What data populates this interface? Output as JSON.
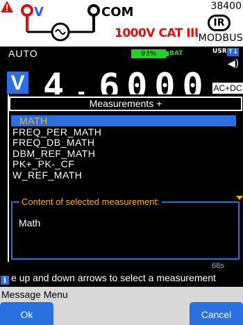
{
  "banner": {
    "v_label": "V",
    "com_label": "COM",
    "cat_rating": "1000V CAT III",
    "baud_rate": "38400",
    "ir_label": "IR",
    "protocol": "MODBUS"
  },
  "status": {
    "range_mode": "AUTO",
    "battery_percent": "93%",
    "battery_label": "BAT",
    "user_label": "USR",
    "user_icon": "↑↓"
  },
  "measurement": {
    "unit_badge": "V",
    "value": "4.6000",
    "coupling": "AC+DC"
  },
  "dialog": {
    "title": "Measurements +",
    "items": [
      "MATH",
      "FREQ_PER_MATH",
      "FREQ_DB_MATH",
      "DBM_REF_MATH",
      "PK+_PK-_CF",
      "W_REF_MATH"
    ],
    "selected_index": 0,
    "content_label": "Content of selected measurement:",
    "content_value": "Math",
    "obscured_text": "68s"
  },
  "hint": {
    "text": "e up and down arrows to select a measurement"
  },
  "message_bar": {
    "label": "Message Menu"
  },
  "softkeys": {
    "ok": "Ok",
    "cancel": "Cancel"
  },
  "colors": {
    "accent_blue": "#2a70e0",
    "highlight_text": "#ffb000",
    "probe_red": "#e01010",
    "battery_green": "#22d422"
  }
}
